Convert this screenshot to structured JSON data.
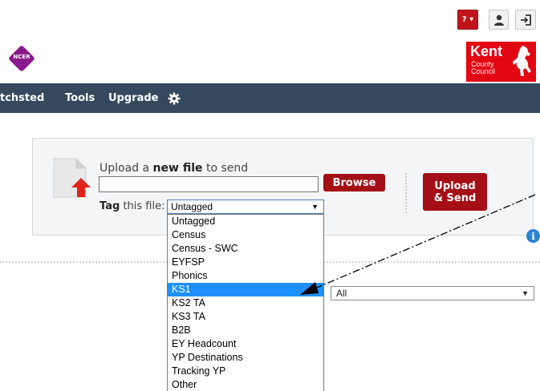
{
  "header": {
    "help_label": "? ▾"
  },
  "logos": {
    "ncer": "NCER",
    "kent_word": "Kent",
    "kent_line1": "County",
    "kent_line2": "Council"
  },
  "nav": {
    "items": [
      "tchsted",
      "Tools",
      "Upgrade"
    ]
  },
  "upload": {
    "label_prefix": "Upload a ",
    "label_bold": "new file",
    "label_suffix": " to send",
    "file_value": "",
    "browse_label": "Browse",
    "tag_label_bold": "Tag",
    "tag_label_rest": " this file:",
    "tag_selected": "Untagged",
    "upload_send_line1": "Upload",
    "upload_send_line2": "& Send"
  },
  "filter": {
    "selected": "All"
  },
  "dropdown": {
    "options": [
      "Untagged",
      "Census",
      "Census - SWC",
      "EYFSP",
      "Phonics",
      "KS1",
      "KS2 TA",
      "KS3 TA",
      "B2B",
      "EY Headcount",
      "YP Destinations",
      "Tracking YP",
      "Other"
    ],
    "highlighted": "KS1"
  },
  "colors": {
    "nav_bg": "#34495e",
    "accent_red": "#a30f14",
    "highlight_blue": "#1e90ff",
    "info_blue": "#2c83d3"
  },
  "icons": [
    "help-icon",
    "user-icon",
    "logout-icon",
    "settings-gear-icon",
    "file-upload-icon",
    "info-icon",
    "dropdown-arrow-icon"
  ]
}
